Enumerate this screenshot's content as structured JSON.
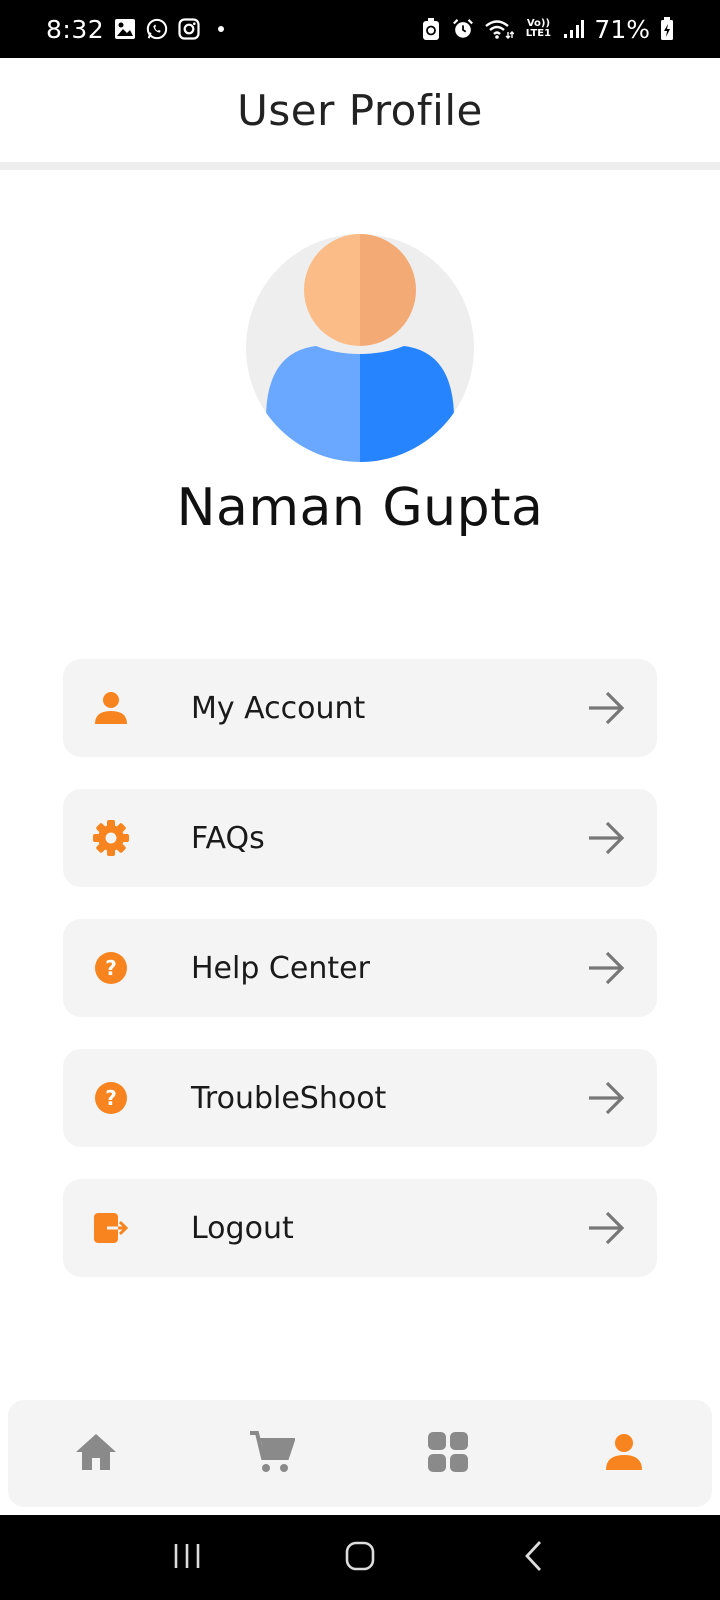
{
  "status_bar": {
    "time": "8:32",
    "battery": "71%",
    "volte_top": "Vo))",
    "volte_bottom": "LTE1",
    "icons": [
      "gallery-icon",
      "whatsapp-icon",
      "instagram-icon",
      "notification-dot",
      "battery-saver-icon",
      "alarm-icon",
      "wifi-icon",
      "volte-icon",
      "signal-icon",
      "battery-icon"
    ]
  },
  "header": {
    "title": "User Profile"
  },
  "profile": {
    "name": "Naman Gupta",
    "avatar_icon": "user-avatar-icon"
  },
  "menu": {
    "items": [
      {
        "label": "My Account",
        "icon": "person-icon"
      },
      {
        "label": "FAQs",
        "icon": "gear-icon"
      },
      {
        "label": "Help Center",
        "icon": "help-circle-icon"
      },
      {
        "label": "TroubleShoot",
        "icon": "help-circle-icon"
      },
      {
        "label": "Logout",
        "icon": "logout-icon"
      }
    ],
    "arrow_icon": "arrow-right-icon"
  },
  "bottom_nav": {
    "items": [
      {
        "icon": "home-icon",
        "active": false
      },
      {
        "icon": "cart-icon",
        "active": false
      },
      {
        "icon": "grid-icon",
        "active": false
      },
      {
        "icon": "person-icon",
        "active": true
      }
    ]
  },
  "colors": {
    "accent": "#f7841e",
    "inactive": "#8a8a8a",
    "card_bg": "#f4f4f4",
    "avatar_face_light": "#fbbc88",
    "avatar_face_dark": "#f4aa74",
    "avatar_body_light": "#6aa8ff",
    "avatar_body_dark": "#2684ff",
    "avatar_bg": "#eeeeee"
  }
}
